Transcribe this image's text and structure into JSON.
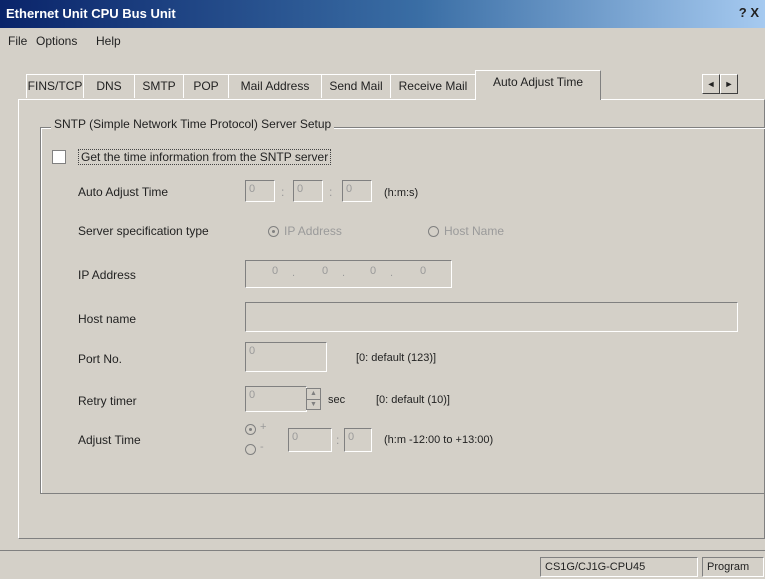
{
  "window": {
    "title": "Ethernet Unit CPU Bus Unit",
    "help": "?",
    "close": "X"
  },
  "menu": [
    "File",
    "Options",
    "Help"
  ],
  "tabs": [
    "FINS/TCP",
    "DNS",
    "SMTP",
    "POP",
    "Mail Address",
    "Send Mail",
    "Receive Mail",
    "Auto Adjust Time"
  ],
  "active_tab": "Auto Adjust Time",
  "tab_scroll": {
    "left": "◄",
    "right": "►"
  },
  "group": {
    "title": "SNTP (Simple Network Time Protocol) Server Setup",
    "checkbox_label": "Get the time information from the SNTP server",
    "checkbox_checked": false
  },
  "fields": {
    "auto_adjust_time": {
      "label": "Auto Adjust Time",
      "h": "0",
      "m": "0",
      "s": "0",
      "unit": "(h:m:s)",
      "sep": ":"
    },
    "server_spec": {
      "label": "Server specification type",
      "opt1": "IP Address",
      "opt2": "Host Name",
      "selected": "IP Address"
    },
    "ip_address": {
      "label": "IP Address",
      "o1": "0",
      "o2": "0",
      "o3": "0",
      "o4": "0",
      "dot": "."
    },
    "host_name": {
      "label": "Host name",
      "value": ""
    },
    "port": {
      "label": "Port No.",
      "value": "0",
      "note": "[0: default (123)]"
    },
    "retry": {
      "label": "Retry timer",
      "value": "0",
      "unit": "sec",
      "note": "[0: default (10)]"
    },
    "adjust_time": {
      "label": "Adjust Time",
      "plus": "+",
      "minus": "-",
      "h": "0",
      "m": "0",
      "note": "(h:m -12:00 to +13:00)"
    }
  },
  "status": {
    "model": "CS1G/CJ1G-CPU45",
    "mode": "Program"
  }
}
